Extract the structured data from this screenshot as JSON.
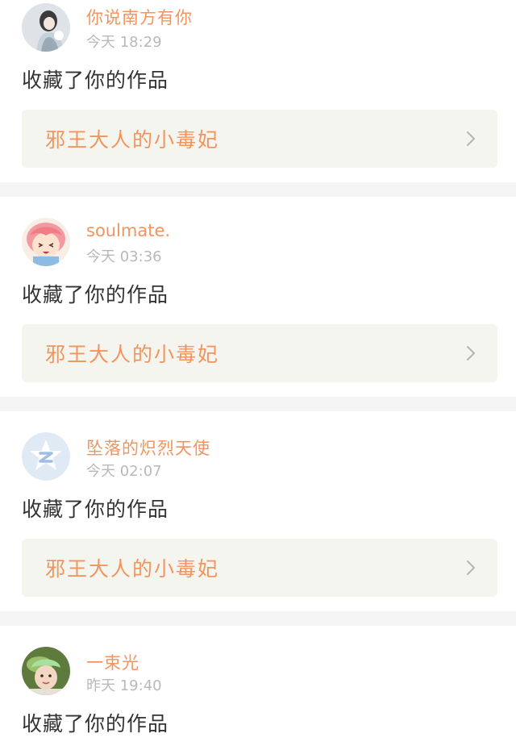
{
  "feed": {
    "items": [
      {
        "username": "你说南方有你",
        "time_day": "今天",
        "time_clock": "18:29",
        "action": "收藏了你的作品",
        "work_title": "邪王大人的小毒妃",
        "avatar_icon": "girl-portrait-avatar"
      },
      {
        "username": "soulmate.",
        "time_day": "今天",
        "time_clock": "03:36",
        "action": "收藏了你的作品",
        "work_title": "邪王大人的小毒妃",
        "avatar_icon": "anime-girl-avatar"
      },
      {
        "username": "坠落的炽烈天使",
        "time_day": "今天",
        "time_clock": "02:07",
        "action": "收藏了你的作品",
        "work_title": "邪王大人的小毒妃",
        "avatar_icon": "default-star-avatar"
      },
      {
        "username": "一束光",
        "time_day": "昨天",
        "time_clock": "19:40",
        "action": "收藏了你的作品",
        "avatar_icon": "child-photo-avatar"
      }
    ]
  },
  "colors": {
    "accent": "#f0955f",
    "time": "#b9b9b9",
    "text": "#333333",
    "work_bg": "#f5f5ef",
    "divider": "#f5f5f5"
  }
}
